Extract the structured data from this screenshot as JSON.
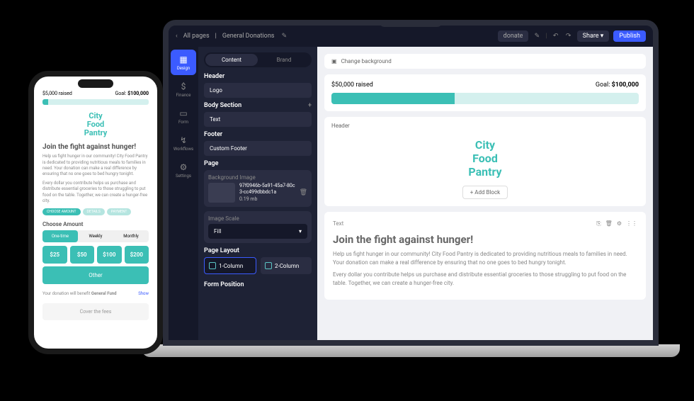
{
  "topbar": {
    "back": "‹",
    "all_pages": "All pages",
    "sep": "|",
    "page_name": "General Donations",
    "donate": "donate",
    "share": "Share ▾",
    "publish": "Publish"
  },
  "rail": [
    {
      "label": "Design"
    },
    {
      "label": "Finance"
    },
    {
      "label": "Form"
    },
    {
      "label": "Workflows"
    },
    {
      "label": "Settings"
    }
  ],
  "panel": {
    "tabs": {
      "content": "Content",
      "brand": "Brand"
    },
    "header": {
      "title": "Header",
      "item": "Logo"
    },
    "body": {
      "title": "Body Section",
      "item": "Text"
    },
    "footer": {
      "title": "Footer",
      "item": "Custom Footer"
    },
    "page": {
      "title": "Page",
      "bg_label": "Background Image",
      "bg_name": "97f0946b-5a91-45a7-80c3-cc499dbbdc1a",
      "bg_size": "0.19 mb",
      "scale_label": "Image Scale",
      "scale_value": "Fill"
    },
    "layout": {
      "title": "Page Layout",
      "col1": "1-Column",
      "col2": "2-Column"
    },
    "form_pos": {
      "title": "Form Position"
    }
  },
  "canvas": {
    "change_bg": "Change background",
    "raised": "$50,000 raised",
    "goal_label": "Goal: ",
    "goal_value": "$100,000",
    "header_label": "Header",
    "logo_l1": "City",
    "logo_l2": "Food",
    "logo_l3": "Pantry",
    "add_block": "+ Add Block",
    "text_label": "Text",
    "h1": "Join the fight against hunger!",
    "p1": "Help us fight hunger in our community! City Food Pantry is dedicated to providing nutritious meals to families in need. Your donation can make a real difference by ensuring that no one goes to bed hungry tonight.",
    "p2": "Every dollar you contribute helps us purchase and distribute essential groceries to those struggling to put food on the table. Together, we can create a hunger-free city."
  },
  "phone": {
    "raised": "$5,000 raised",
    "goal_label": "Goal: ",
    "goal_value": "$100,000",
    "logo_l1": "City",
    "logo_l2": "Food",
    "logo_l3": "Pantry",
    "h1": "Join the fight against hunger!",
    "p1": "Help us fight hunger in our community! City Food Pantry is dedicated to providing nutritious meals to families in need. Your donation can make a real difference by ensuring that no one goes to bed hungry tonight.",
    "p2": "Every dollar you contribute helps us purchase and distribute essential groceries to those struggling to put food on the table. Together, we can create a hunger-free city.",
    "chips": [
      "CHOOSE AMOUNT",
      "DETAILS",
      "PAYMENT"
    ],
    "choose": "Choose Amount",
    "freq": [
      "One-time",
      "Weekly",
      "Monthly"
    ],
    "amounts": [
      "$25",
      "$50",
      "$100",
      "$200"
    ],
    "other": "Other",
    "benefit_pre": "Your donation will benefit ",
    "benefit_fund": "General Fund",
    "show": "Show",
    "cover": "Cover the fees"
  }
}
